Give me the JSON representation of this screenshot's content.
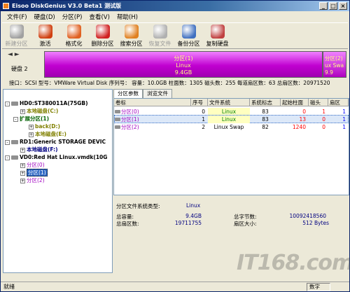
{
  "window": {
    "title": "Eisoo DiskGenius V3.0 Beta1 测试版"
  },
  "menu": [
    "文件(F)",
    "硬盘(D)",
    "分区(P)",
    "查看(V)",
    "帮助(H)"
  ],
  "toolbar": [
    {
      "label": "新建分区",
      "icon": "new-partition-icon",
      "color": "#a0a0a0",
      "disabled": true
    },
    {
      "label": "激活",
      "icon": "activate-icon",
      "color": "#d04010"
    },
    {
      "label": "格式化",
      "icon": "format-icon",
      "color": "#e06020"
    },
    {
      "label": "删除分区",
      "icon": "delete-icon",
      "color": "#d02020"
    },
    {
      "label": "搜索分区",
      "icon": "search-icon",
      "color": "#e08020"
    },
    {
      "label": "恢复文件",
      "icon": "recover-icon",
      "color": "#b0b0b0",
      "disabled": true
    },
    {
      "label": "备份分区",
      "icon": "backup-icon",
      "color": "#4070c0"
    },
    {
      "label": "复制硬盘",
      "icon": "copy-disk-icon",
      "color": "#c04040"
    }
  ],
  "diskmap": {
    "disk_label": "硬盘 2",
    "part1": {
      "line1": "分区(1)",
      "line2": "Linux",
      "line3": "9.4GB"
    },
    "part2": {
      "line1": "分区(2)",
      "line2": "ux Swa",
      "line3": "9.9"
    }
  },
  "info_line": "接口：SCSI   型号：VMWare Virtual Disk   序列号：   容量：10.0GB   柱面数：1305   磁头数：255   每道扇区数：63   总扇区数：20971520",
  "tree": {
    "hd0": "HD0:ST380011A(75GB)",
    "hd0_c": "本地磁盘(C:)",
    "hd0_ext": "扩展分区(1)",
    "hd0_back": "back(D:)",
    "hd0_e": "本地磁盘(E:)",
    "rd1": "RD1:Generic STORAGE DEVIC",
    "rd1_f": "本地磁盘(F:)",
    "vd0": "VD0:Red Hat Linux.vmdk(10G",
    "vd0_p0": "分区(0)",
    "vd0_p1": "分区(1)",
    "vd0_p2": "分区(2)"
  },
  "tabs": [
    "分区参数",
    "浏览文件"
  ],
  "table": {
    "headers": [
      "卷标",
      "序号",
      "文件系统",
      "系统标志",
      "起始柱面",
      "磁头",
      "扇区"
    ],
    "rows": [
      {
        "label": "分区(0)",
        "index": "0",
        "fs": "Linux",
        "flag": "83",
        "cyl": "0",
        "head": "1",
        "sec": "1"
      },
      {
        "label": "分区(1)",
        "index": "1",
        "fs": "Linux",
        "flag": "83",
        "cyl": "13",
        "head": "0",
        "sec": "1"
      },
      {
        "label": "分区(2)",
        "index": "2",
        "fs": "Linux Swap",
        "flag": "82",
        "cyl": "1240",
        "head": "0",
        "sec": "1"
      }
    ]
  },
  "detail": {
    "fs_type_label": "分区文件系统类型:",
    "fs_type": "Linux",
    "capacity_label": "总容量:",
    "capacity": "9.4GB",
    "total_bytes_label": "总字节数:",
    "total_bytes": "10092418560",
    "sectors_label": "总扇区数:",
    "sectors": "19711755",
    "sector_size_label": "扇区大小:",
    "sector_size": "512 Bytes"
  },
  "status": {
    "text": "就绪",
    "num": "数字"
  },
  "watermark": "IT168.com"
}
